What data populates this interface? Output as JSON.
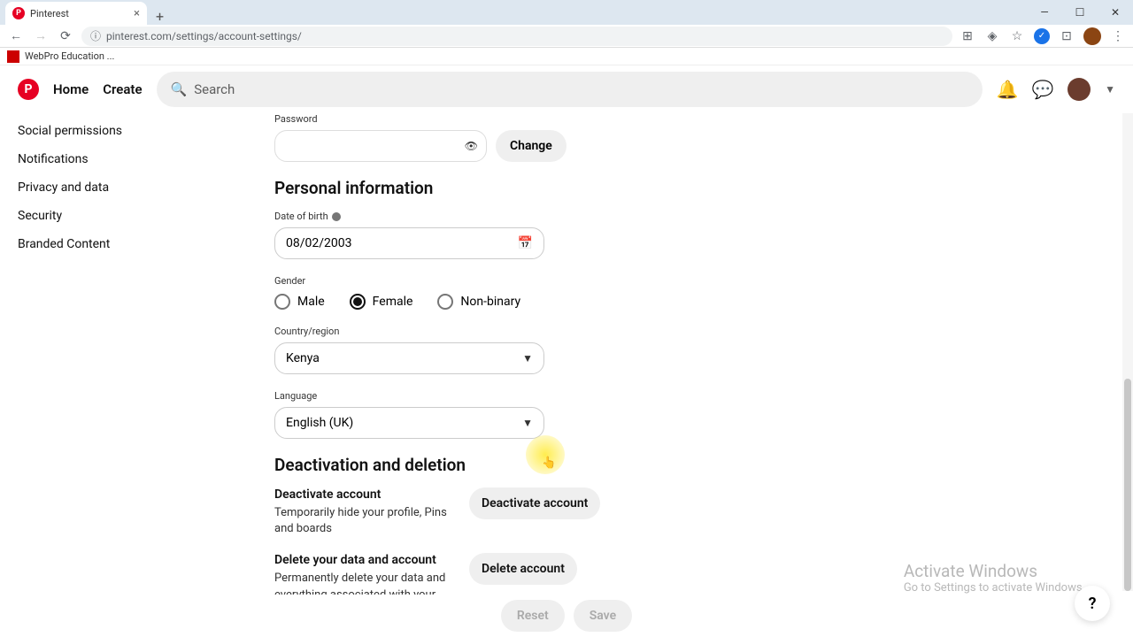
{
  "browser": {
    "tab_title": "Pinterest",
    "url": "pinterest.com/settings/account-settings/",
    "bookmark": "WebPro Education ..."
  },
  "header": {
    "home": "Home",
    "create": "Create",
    "search_placeholder": "Search"
  },
  "sidebar": {
    "items": [
      "Social permissions",
      "Notifications",
      "Privacy and data",
      "Security",
      "Branded Content"
    ]
  },
  "password": {
    "label": "Password",
    "change_btn": "Change"
  },
  "personal": {
    "section_title": "Personal information",
    "dob_label": "Date of birth",
    "dob_value": "08/02/2003",
    "gender_label": "Gender",
    "gender_options": {
      "male": "Male",
      "female": "Female",
      "nonbinary": "Non-binary"
    },
    "gender_selected": "female",
    "country_label": "Country/region",
    "country_value": "Kenya",
    "language_label": "Language",
    "language_value": "English (UK)"
  },
  "deactivation": {
    "section_title": "Deactivation and deletion",
    "deactivate_title": "Deactivate account",
    "deactivate_desc": "Temporarily hide your profile, Pins and boards",
    "deactivate_btn": "Deactivate account",
    "delete_title": "Delete your data and account",
    "delete_desc": "Permanently delete your data and everything associated with your account",
    "delete_btn": "Delete account"
  },
  "footer": {
    "reset": "Reset",
    "save": "Save"
  },
  "watermark": {
    "title": "Activate Windows",
    "sub": "Go to Settings to activate Windows."
  },
  "help": "?"
}
